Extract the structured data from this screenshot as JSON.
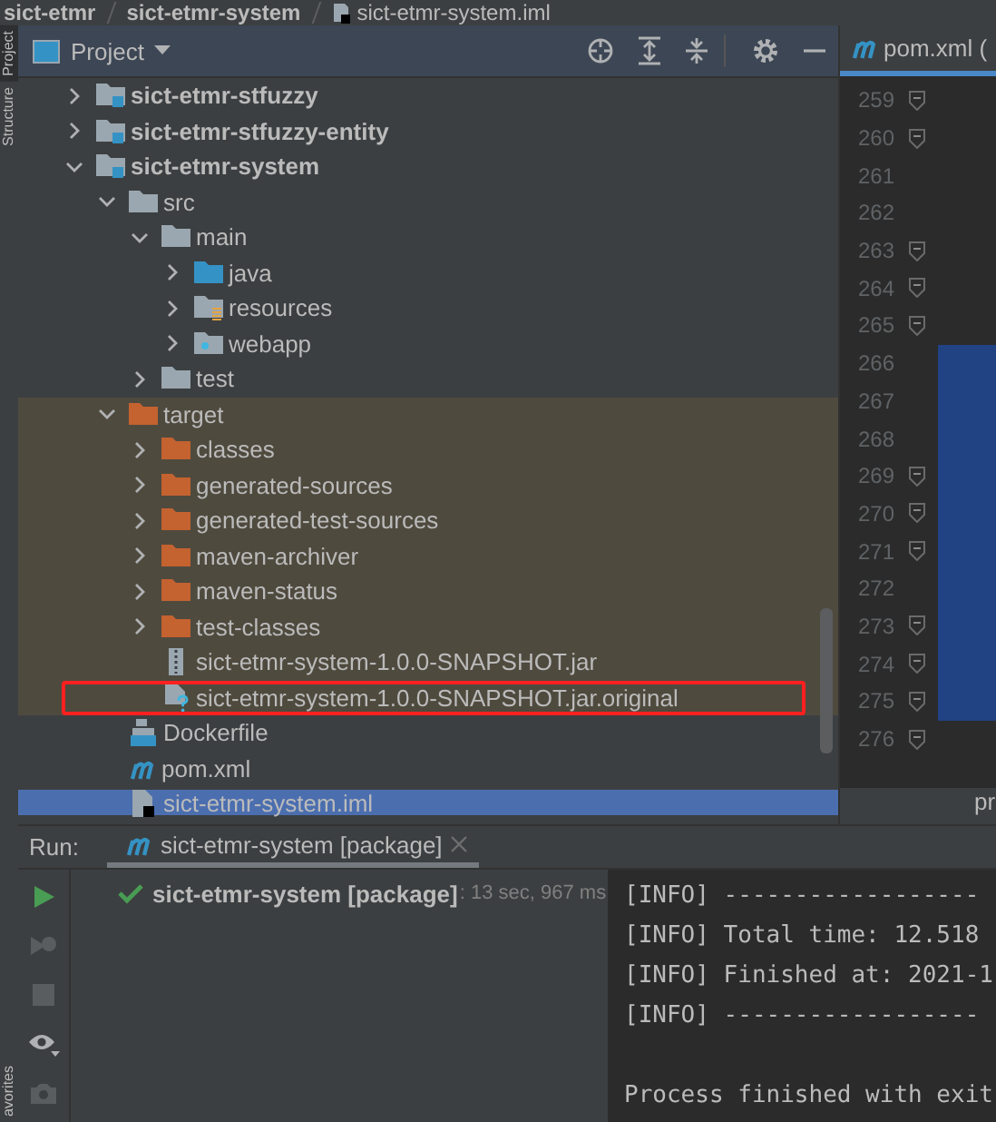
{
  "breadcrumb": [
    "sict-etmr",
    "sict-etmr-system",
    "sict-etmr-system.iml"
  ],
  "side_tabs": [
    {
      "label": "Project",
      "selected": true
    },
    {
      "label": "Structure",
      "selected": false
    }
  ],
  "bottom_side_tabs": [
    {
      "label": "avorites",
      "selected": false
    }
  ],
  "project_panel": {
    "title": "Project",
    "tree": [
      {
        "label": "sict-etmr-stfuzzy",
        "kind": "module",
        "expanded": false,
        "selected": false,
        "excluded": false,
        "marked": false
      },
      {
        "label": "sict-etmr-stfuzzy-entity",
        "kind": "module",
        "expanded": false,
        "selected": false,
        "excluded": false,
        "marked": false
      },
      {
        "label": "sict-etmr-system",
        "kind": "module",
        "expanded": true,
        "selected": false,
        "excluded": false,
        "marked": false,
        "children": [
          {
            "label": "src",
            "kind": "folder",
            "expanded": true,
            "selected": false,
            "excluded": false,
            "marked": false,
            "children": [
              {
                "label": "main",
                "kind": "folder",
                "expanded": true,
                "selected": false,
                "excluded": false,
                "marked": false,
                "children": [
                  {
                    "label": "java",
                    "kind": "source",
                    "expanded": false,
                    "selected": false,
                    "excluded": false,
                    "marked": false
                  },
                  {
                    "label": "resources",
                    "kind": "resources",
                    "expanded": false,
                    "selected": false,
                    "excluded": false,
                    "marked": false
                  },
                  {
                    "label": "webapp",
                    "kind": "web",
                    "expanded": false,
                    "selected": false,
                    "excluded": false,
                    "marked": false
                  }
                ]
              },
              {
                "label": "test",
                "kind": "folder",
                "expanded": false,
                "selected": false,
                "excluded": false,
                "marked": false
              }
            ]
          },
          {
            "label": "target",
            "kind": "folder",
            "expanded": true,
            "selected": false,
            "excluded": true,
            "marked": false,
            "children": [
              {
                "label": "classes",
                "kind": "folder",
                "expanded": false,
                "selected": false,
                "excluded": true,
                "marked": false
              },
              {
                "label": "generated-sources",
                "kind": "folder",
                "expanded": false,
                "selected": false,
                "excluded": true,
                "marked": false
              },
              {
                "label": "generated-test-sources",
                "kind": "folder",
                "expanded": false,
                "selected": false,
                "excluded": true,
                "marked": false
              },
              {
                "label": "maven-archiver",
                "kind": "folder",
                "expanded": false,
                "selected": false,
                "excluded": true,
                "marked": false
              },
              {
                "label": "maven-status",
                "kind": "folder",
                "expanded": false,
                "selected": false,
                "excluded": true,
                "marked": false
              },
              {
                "label": "test-classes",
                "kind": "folder",
                "expanded": false,
                "selected": false,
                "excluded": true,
                "marked": false
              },
              {
                "label": "sict-etmr-system-1.0.0-SNAPSHOT.jar",
                "kind": "jar",
                "selected": false,
                "excluded": true,
                "marked": false
              },
              {
                "label": "sict-etmr-system-1.0.0-SNAPSHOT.jar.original",
                "kind": "unknown",
                "selected": false,
                "excluded": true,
                "marked": true
              }
            ]
          },
          {
            "label": "Dockerfile",
            "kind": "docker",
            "selected": false,
            "excluded": false,
            "marked": false
          },
          {
            "label": "pom.xml",
            "kind": "maven",
            "selected": false,
            "excluded": false,
            "marked": false
          },
          {
            "label": "sict-etmr-system.iml",
            "kind": "iml",
            "selected": true,
            "excluded": false,
            "marked": false
          }
        ]
      }
    ]
  },
  "editor": {
    "tab": "pom.xml (",
    "bottom_tab": "pr",
    "lines": [
      {
        "number": "259",
        "fold": true,
        "highlighted": false
      },
      {
        "number": "260",
        "fold": true,
        "highlighted": false
      },
      {
        "number": "261",
        "fold": false,
        "highlighted": false
      },
      {
        "number": "262",
        "fold": false,
        "highlighted": false
      },
      {
        "number": "263",
        "fold": true,
        "highlighted": false
      },
      {
        "number": "264",
        "fold": true,
        "highlighted": false
      },
      {
        "number": "265",
        "fold": true,
        "highlighted": false
      },
      {
        "number": "266",
        "fold": false,
        "highlighted": true
      },
      {
        "number": "267",
        "fold": false,
        "highlighted": true
      },
      {
        "number": "268",
        "fold": false,
        "highlighted": true
      },
      {
        "number": "269",
        "fold": true,
        "highlighted": true
      },
      {
        "number": "270",
        "fold": true,
        "highlighted": true
      },
      {
        "number": "271",
        "fold": true,
        "highlighted": true
      },
      {
        "number": "272",
        "fold": false,
        "highlighted": true
      },
      {
        "number": "273",
        "fold": true,
        "highlighted": true
      },
      {
        "number": "274",
        "fold": true,
        "highlighted": true
      },
      {
        "number": "275",
        "fold": true,
        "highlighted": true
      },
      {
        "number": "276",
        "fold": true,
        "highlighted": false
      }
    ]
  },
  "run_panel": {
    "label": "Run:",
    "tabs": [
      {
        "label": "sict-etmr-system [package]",
        "selected": true
      }
    ],
    "tree": [
      {
        "label": "sict-etmr-system [package]",
        "detail": ": 13 sec, 967 ms"
      }
    ],
    "console": [
      {
        "text": "[INFO] ------------------",
        "spaced": false
      },
      {
        "text": "[INFO] Total time: 12.518",
        "spaced": false
      },
      {
        "text": "[INFO] Finished at: 2021-1",
        "spaced": false
      },
      {
        "text": "[INFO] ------------------",
        "spaced": false
      },
      {
        "text": "Process finished with exit",
        "spaced": true
      }
    ]
  }
}
